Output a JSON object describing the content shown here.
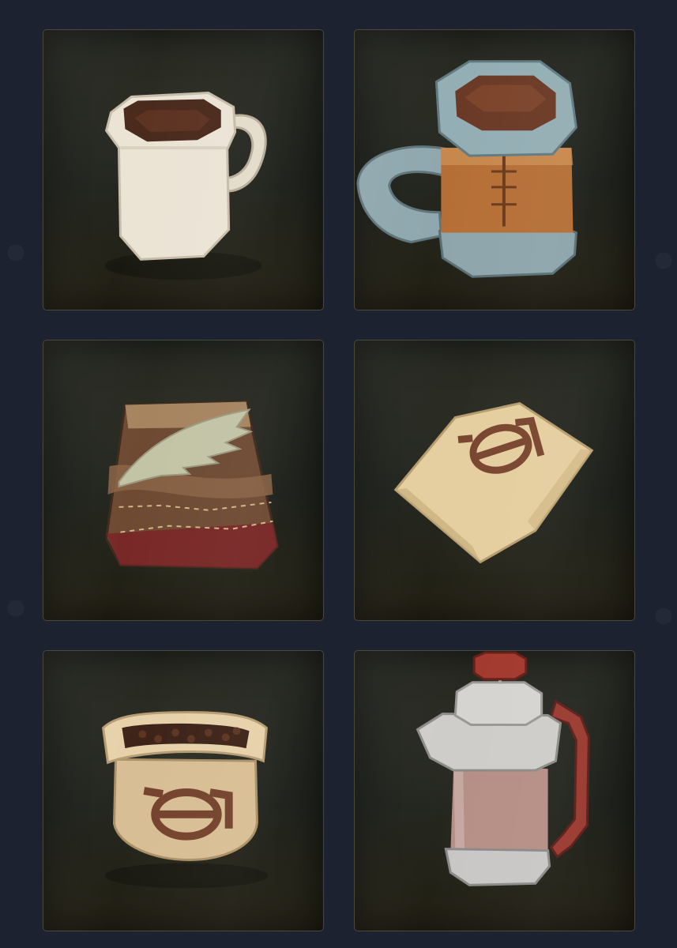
{
  "gallery": {
    "items": [
      {
        "icon": "white-coffee-mug-icon"
      },
      {
        "icon": "metal-banded-tankard-icon"
      },
      {
        "icon": "patchwork-bedroll-icon"
      },
      {
        "icon": "sealed-coffee-bag-icon"
      },
      {
        "icon": "open-coffee-bean-sack-icon"
      },
      {
        "icon": "french-press-icon"
      }
    ],
    "colors": {
      "background": "#1c2230",
      "tile_border": "#4a4838",
      "tile_fill": "#22241d"
    }
  }
}
